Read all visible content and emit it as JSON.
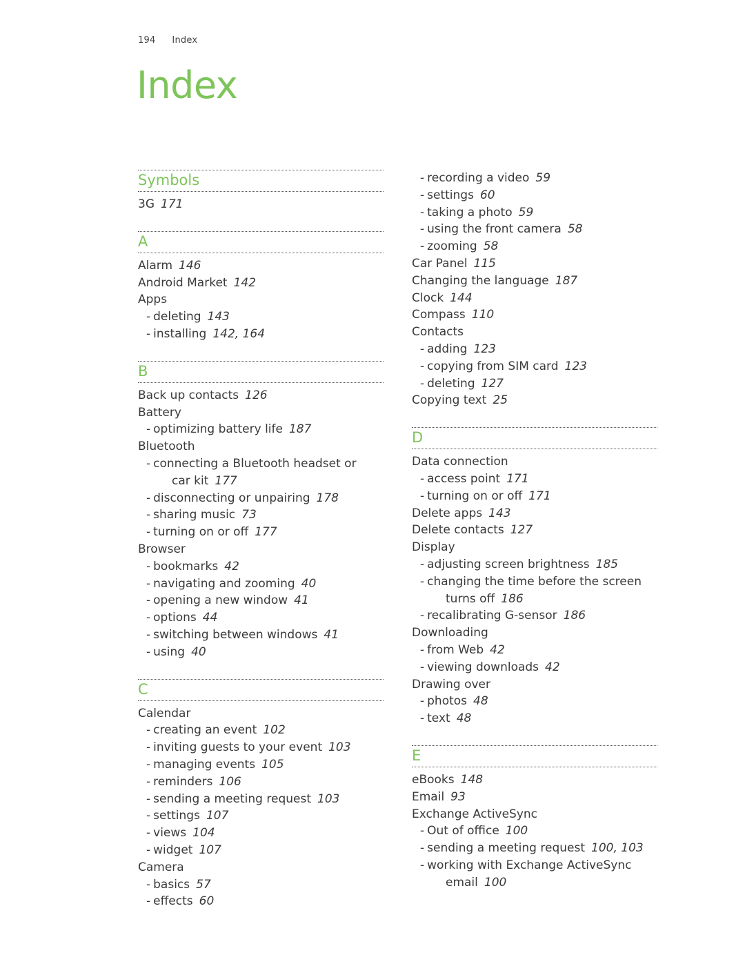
{
  "header": {
    "page_number": "194",
    "section": "Index"
  },
  "title": "Index",
  "left_column": [
    {
      "type": "section",
      "label": "Symbols"
    },
    {
      "type": "entry",
      "level": 0,
      "text": "3G",
      "pages": "171"
    },
    {
      "type": "gap"
    },
    {
      "type": "section",
      "label": "A"
    },
    {
      "type": "entry",
      "level": 0,
      "text": "Alarm",
      "pages": "146"
    },
    {
      "type": "entry",
      "level": 0,
      "text": "Android Market",
      "pages": "142"
    },
    {
      "type": "entry",
      "level": 0,
      "text": "Apps",
      "pages": ""
    },
    {
      "type": "entry",
      "level": 1,
      "text": "deleting",
      "pages": "143"
    },
    {
      "type": "entry",
      "level": 1,
      "text": "installing",
      "pages": "142, 164"
    },
    {
      "type": "gap"
    },
    {
      "type": "section",
      "label": "B"
    },
    {
      "type": "entry",
      "level": 0,
      "text": "Back up contacts",
      "pages": "126"
    },
    {
      "type": "entry",
      "level": 0,
      "text": "Battery",
      "pages": ""
    },
    {
      "type": "entry",
      "level": 1,
      "text": "optimizing battery life",
      "pages": "187"
    },
    {
      "type": "entry",
      "level": 0,
      "text": "Bluetooth",
      "pages": ""
    },
    {
      "type": "entry",
      "level": 1,
      "text": "connecting a Bluetooth headset or",
      "pages": ""
    },
    {
      "type": "entry",
      "level": 2,
      "text": "car kit",
      "pages": "177"
    },
    {
      "type": "entry",
      "level": 1,
      "text": "disconnecting or unpairing",
      "pages": "178"
    },
    {
      "type": "entry",
      "level": 1,
      "text": "sharing music",
      "pages": "73"
    },
    {
      "type": "entry",
      "level": 1,
      "text": "turning on or off",
      "pages": "177"
    },
    {
      "type": "entry",
      "level": 0,
      "text": "Browser",
      "pages": ""
    },
    {
      "type": "entry",
      "level": 1,
      "text": "bookmarks",
      "pages": "42"
    },
    {
      "type": "entry",
      "level": 1,
      "text": "navigating and zooming",
      "pages": "40"
    },
    {
      "type": "entry",
      "level": 1,
      "text": "opening a new window",
      "pages": "41"
    },
    {
      "type": "entry",
      "level": 1,
      "text": "options",
      "pages": "44"
    },
    {
      "type": "entry",
      "level": 1,
      "text": "switching between windows",
      "pages": "41"
    },
    {
      "type": "entry",
      "level": 1,
      "text": "using",
      "pages": "40"
    },
    {
      "type": "gap"
    },
    {
      "type": "section",
      "label": "C"
    },
    {
      "type": "entry",
      "level": 0,
      "text": "Calendar",
      "pages": ""
    },
    {
      "type": "entry",
      "level": 1,
      "text": "creating an event",
      "pages": "102"
    },
    {
      "type": "entry",
      "level": 1,
      "text": "inviting guests to your event",
      "pages": "103"
    },
    {
      "type": "entry",
      "level": 1,
      "text": "managing events",
      "pages": "105"
    },
    {
      "type": "entry",
      "level": 1,
      "text": "reminders",
      "pages": "106"
    },
    {
      "type": "entry",
      "level": 1,
      "text": "sending a meeting request",
      "pages": "103"
    },
    {
      "type": "entry",
      "level": 1,
      "text": "settings",
      "pages": "107"
    },
    {
      "type": "entry",
      "level": 1,
      "text": "views",
      "pages": "104"
    },
    {
      "type": "entry",
      "level": 1,
      "text": "widget",
      "pages": "107"
    },
    {
      "type": "entry",
      "level": 0,
      "text": "Camera",
      "pages": ""
    },
    {
      "type": "entry",
      "level": 1,
      "text": "basics",
      "pages": "57"
    },
    {
      "type": "entry",
      "level": 1,
      "text": "effects",
      "pages": "60"
    }
  ],
  "right_column": [
    {
      "type": "entry",
      "level": 1,
      "text": "recording a video",
      "pages": "59"
    },
    {
      "type": "entry",
      "level": 1,
      "text": "settings",
      "pages": "60"
    },
    {
      "type": "entry",
      "level": 1,
      "text": "taking a photo",
      "pages": "59"
    },
    {
      "type": "entry",
      "level": 1,
      "text": "using the front camera",
      "pages": "58"
    },
    {
      "type": "entry",
      "level": 1,
      "text": "zooming",
      "pages": "58"
    },
    {
      "type": "entry",
      "level": 0,
      "text": "Car Panel",
      "pages": "115"
    },
    {
      "type": "entry",
      "level": 0,
      "text": "Changing the language",
      "pages": "187"
    },
    {
      "type": "entry",
      "level": 0,
      "text": "Clock",
      "pages": "144"
    },
    {
      "type": "entry",
      "level": 0,
      "text": "Compass",
      "pages": "110"
    },
    {
      "type": "entry",
      "level": 0,
      "text": "Contacts",
      "pages": ""
    },
    {
      "type": "entry",
      "level": 1,
      "text": "adding",
      "pages": "123"
    },
    {
      "type": "entry",
      "level": 1,
      "text": "copying from SIM card",
      "pages": "123"
    },
    {
      "type": "entry",
      "level": 1,
      "text": "deleting",
      "pages": "127"
    },
    {
      "type": "entry",
      "level": 0,
      "text": "Copying text",
      "pages": "25"
    },
    {
      "type": "gap"
    },
    {
      "type": "section",
      "label": "D"
    },
    {
      "type": "entry",
      "level": 0,
      "text": "Data connection",
      "pages": ""
    },
    {
      "type": "entry",
      "level": 1,
      "text": "access point",
      "pages": "171"
    },
    {
      "type": "entry",
      "level": 1,
      "text": "turning on or off",
      "pages": "171"
    },
    {
      "type": "entry",
      "level": 0,
      "text": "Delete apps",
      "pages": "143"
    },
    {
      "type": "entry",
      "level": 0,
      "text": "Delete contacts",
      "pages": "127"
    },
    {
      "type": "entry",
      "level": 0,
      "text": "Display",
      "pages": ""
    },
    {
      "type": "entry",
      "level": 1,
      "text": "adjusting screen brightness",
      "pages": "185"
    },
    {
      "type": "entry",
      "level": 1,
      "text": "changing the time before the screen",
      "pages": ""
    },
    {
      "type": "entry",
      "level": 2,
      "text": "turns off",
      "pages": "186"
    },
    {
      "type": "entry",
      "level": 1,
      "text": "recalibrating G-sensor",
      "pages": "186"
    },
    {
      "type": "entry",
      "level": 0,
      "text": "Downloading",
      "pages": ""
    },
    {
      "type": "entry",
      "level": 1,
      "text": "from Web",
      "pages": "42"
    },
    {
      "type": "entry",
      "level": 1,
      "text": "viewing downloads",
      "pages": "42"
    },
    {
      "type": "entry",
      "level": 0,
      "text": "Drawing over",
      "pages": ""
    },
    {
      "type": "entry",
      "level": 1,
      "text": "photos",
      "pages": "48"
    },
    {
      "type": "entry",
      "level": 1,
      "text": "text",
      "pages": "48"
    },
    {
      "type": "gap"
    },
    {
      "type": "section",
      "label": "E"
    },
    {
      "type": "entry",
      "level": 0,
      "text": "eBooks",
      "pages": "148"
    },
    {
      "type": "entry",
      "level": 0,
      "text": "Email",
      "pages": "93"
    },
    {
      "type": "entry",
      "level": 0,
      "text": "Exchange ActiveSync",
      "pages": ""
    },
    {
      "type": "entry",
      "level": 1,
      "text": "Out of office",
      "pages": "100"
    },
    {
      "type": "entry",
      "level": 1,
      "text": "sending a meeting request",
      "pages": "100, 103"
    },
    {
      "type": "entry",
      "level": 1,
      "text": "working with Exchange ActiveSync",
      "pages": ""
    },
    {
      "type": "entry",
      "level": 2,
      "text": "email",
      "pages": "100"
    }
  ],
  "colors": {
    "accent": "#7dc45a",
    "text": "#3a3a3a"
  },
  "dash": "-"
}
